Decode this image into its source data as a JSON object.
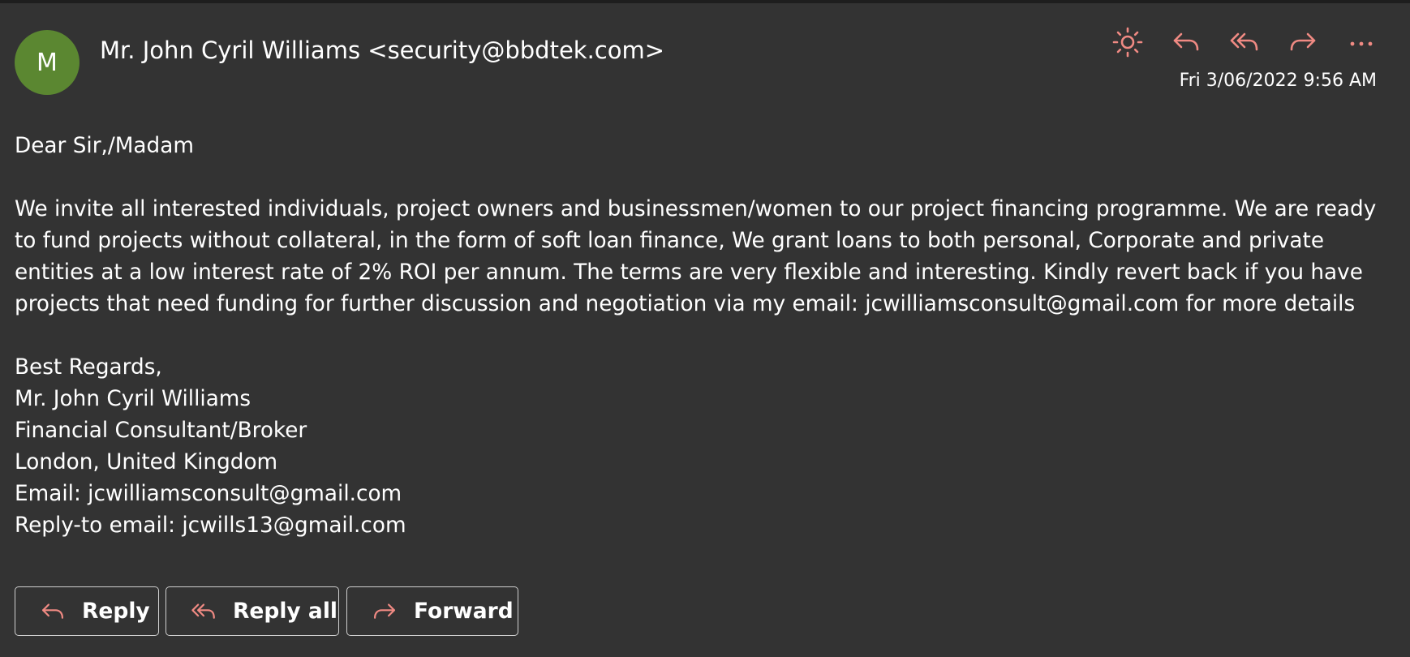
{
  "colors": {
    "background": "#333333",
    "text": "#ffffff",
    "accent": "#f08a83",
    "avatar": "#5b8731",
    "button_border": "#cfcfcf"
  },
  "header": {
    "avatar_initial": "M",
    "sender": "Mr. John Cyril Williams <security@bbdtek.com>",
    "timestamp": "Fri 3/06/2022 9:56 AM"
  },
  "toolbar": {
    "icons": [
      "sun-icon",
      "reply-icon",
      "reply-all-icon",
      "forward-icon",
      "more-icon"
    ]
  },
  "message": {
    "greeting": "Dear Sir,/Madam",
    "paragraph": "We invite all interested individuals, project owners and businessmen/women to our project financing programme. We are ready to fund projects without collateral, in the form of soft loan finance, We grant loans to both personal, Corporate and private entities at a low interest rate of 2% ROI per annum. The terms are very flexible and interesting. Kindly revert back if you have projects that need funding for further discussion and negotiation via my email: jcwilliamsconsult@gmail.com for more details",
    "signature": [
      "Best Regards,",
      "Mr. John Cyril Williams",
      "Financial Consultant/Broker",
      "London, United Kingdom",
      "Email: jcwilliamsconsult@gmail.com",
      "Reply-to email: jcwills13@gmail.com"
    ]
  },
  "actions": {
    "reply_label": "Reply",
    "reply_all_label": "Reply all",
    "forward_label": "Forward"
  }
}
